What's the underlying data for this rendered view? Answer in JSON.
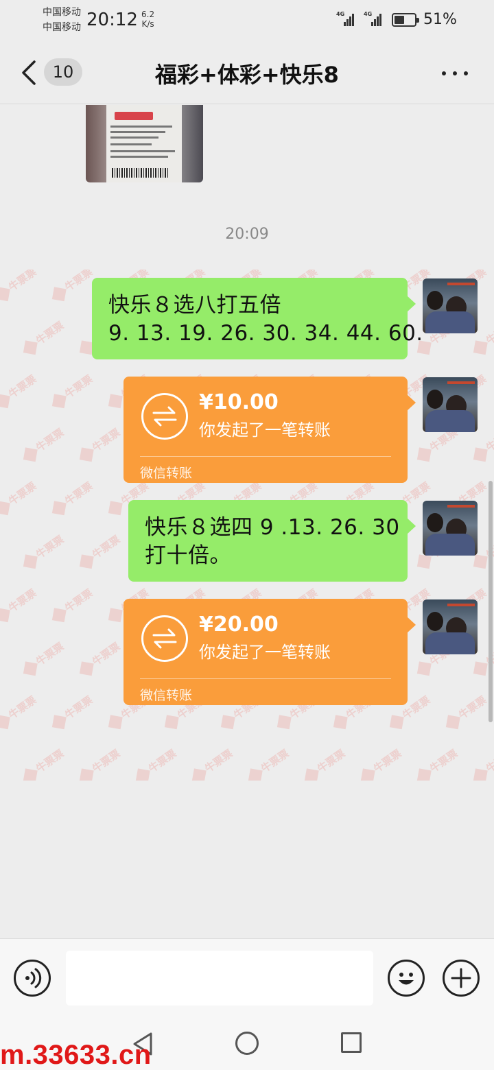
{
  "status_bar": {
    "carrier_1": "中国移动",
    "carrier_2": "中国移动",
    "time": "20:12",
    "net_speed_value": "6.2",
    "net_speed_unit": "K/s",
    "signal_1_label": "4G",
    "signal_2_label": "4G",
    "battery_percent": "51%",
    "battery_level": 0.51
  },
  "nav": {
    "back_icon": "chevron-left-icon",
    "unread_count": "10",
    "title": "福彩+体彩+快乐8",
    "more_icon": "more-dots-icon"
  },
  "chat": {
    "timestamp": "20:09",
    "watermark_text": "牛票票",
    "messages": [
      {
        "type": "image",
        "description_icon": "lottery-receipt-photo"
      },
      {
        "type": "text",
        "text": "快乐８选八打五倍\n9. 13. 19. 26. 30. 34. 44. 60."
      },
      {
        "type": "transfer",
        "amount": "¥10.00",
        "description": "你发起了一笔转账",
        "label": "微信转账"
      },
      {
        "type": "text",
        "text": "快乐８选四 9 .13. 26. 30\n打十倍。"
      },
      {
        "type": "transfer",
        "amount": "¥20.00",
        "description": "你发起了一笔转账",
        "label": "微信转账"
      }
    ]
  },
  "input_bar": {
    "voice_icon": "voice-icon",
    "message_value": "",
    "emoji_icon": "emoji-icon",
    "plus_icon": "plus-icon"
  },
  "overlay": {
    "url_text": "m.33633.cn"
  },
  "colors": {
    "background": "#ededed",
    "sent_bubble": "#95ec69",
    "transfer_bubble": "#fa9d3b",
    "watermark": "#e01818"
  }
}
